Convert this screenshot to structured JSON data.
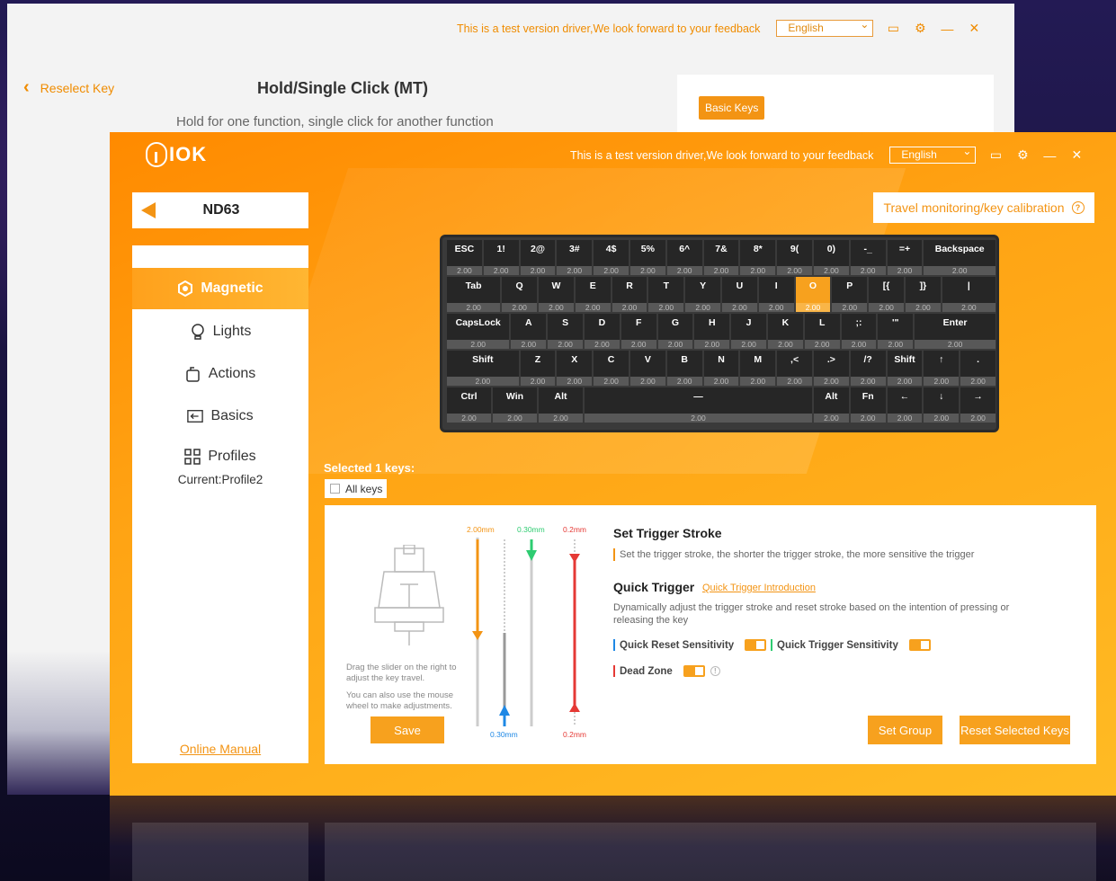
{
  "back_window": {
    "notice": "This is a test version driver,We look forward to your feedback",
    "language": "English",
    "reselect_label": "Reselect Key",
    "title": "Hold/Single Click (MT)",
    "subtitle": "Hold for one function, single click for another function",
    "basic_keys_label": "Basic Keys"
  },
  "main_window": {
    "logo_text": "IOK",
    "notice": "This is a test version driver,We look forward to your feedback",
    "language": "English",
    "device_name": "ND63",
    "travel_button": "Travel monitoring/key calibration",
    "colors": {
      "accent": "#f7a11e",
      "background": "#ff9a0a",
      "trigger_red": "#e53935",
      "trigger_green": "#2ecc71",
      "trigger_blue": "#1e88e5"
    }
  },
  "sidebar": {
    "items": [
      {
        "label": "Magnetic",
        "icon": "hexagon-icon",
        "active": true
      },
      {
        "label": "Lights",
        "icon": "lightbulb-icon",
        "active": false
      },
      {
        "label": "Actions",
        "icon": "actions-icon",
        "active": false
      },
      {
        "label": "Basics",
        "icon": "basics-icon",
        "active": false
      },
      {
        "label": "Profiles",
        "icon": "grid-icon",
        "active": false
      }
    ],
    "current_profile": "Current:Profile2",
    "manual_link": "Online Manual"
  },
  "keyboard": {
    "rows": [
      {
        "keys": [
          {
            "label": "ESC",
            "value": "2.00"
          },
          {
            "label": "1!",
            "value": "2.00"
          },
          {
            "label": "2@",
            "value": "2.00"
          },
          {
            "label": "3#",
            "value": "2.00"
          },
          {
            "label": "4$",
            "value": "2.00"
          },
          {
            "label": "5%",
            "value": "2.00"
          },
          {
            "label": "6^",
            "value": "2.00"
          },
          {
            "label": "7&",
            "value": "2.00"
          },
          {
            "label": "8*",
            "value": "2.00"
          },
          {
            "label": "9(",
            "value": "2.00"
          },
          {
            "label": "0)",
            "value": "2.00"
          },
          {
            "label": "-_",
            "value": "2.00"
          },
          {
            "label": "=+",
            "value": "2.00"
          },
          {
            "label": "Backspace",
            "value": "2.00",
            "w": 2
          }
        ]
      },
      {
        "keys": [
          {
            "label": "Tab",
            "value": "2.00",
            "w": 1.5
          },
          {
            "label": "Q",
            "value": "2.00"
          },
          {
            "label": "W",
            "value": "2.00"
          },
          {
            "label": "E",
            "value": "2.00"
          },
          {
            "label": "R",
            "value": "2.00"
          },
          {
            "label": "T",
            "value": "2.00"
          },
          {
            "label": "Y",
            "value": "2.00"
          },
          {
            "label": "U",
            "value": "2.00"
          },
          {
            "label": "I",
            "value": "2.00"
          },
          {
            "label": "O",
            "value": "2.00",
            "selected": true
          },
          {
            "label": "P",
            "value": "2.00"
          },
          {
            "label": "[{",
            "value": "2.00"
          },
          {
            "label": "]}",
            "value": "2.00"
          },
          {
            "label": "|",
            "value": "2.00",
            "w": 1.5
          }
        ]
      },
      {
        "keys": [
          {
            "label": "CapsLock",
            "value": "2.00",
            "w": 1.75
          },
          {
            "label": "A",
            "value": "2.00"
          },
          {
            "label": "S",
            "value": "2.00"
          },
          {
            "label": "D",
            "value": "2.00"
          },
          {
            "label": "F",
            "value": "2.00"
          },
          {
            "label": "G",
            "value": "2.00"
          },
          {
            "label": "H",
            "value": "2.00"
          },
          {
            "label": "J",
            "value": "2.00"
          },
          {
            "label": "K",
            "value": "2.00"
          },
          {
            "label": "L",
            "value": "2.00"
          },
          {
            "label": ";:",
            "value": "2.00"
          },
          {
            "label": "'\"",
            "value": "2.00"
          },
          {
            "label": "Enter",
            "value": "2.00",
            "w": 2.25
          }
        ]
      },
      {
        "keys": [
          {
            "label": "Shift",
            "value": "2.00",
            "w": 2
          },
          {
            "label": "Z",
            "value": "2.00"
          },
          {
            "label": "X",
            "value": "2.00"
          },
          {
            "label": "C",
            "value": "2.00"
          },
          {
            "label": "V",
            "value": "2.00"
          },
          {
            "label": "B",
            "value": "2.00"
          },
          {
            "label": "N",
            "value": "2.00"
          },
          {
            "label": "M",
            "value": "2.00"
          },
          {
            "label": ",<",
            "value": "2.00"
          },
          {
            "label": ".>",
            "value": "2.00"
          },
          {
            "label": "/?",
            "value": "2.00"
          },
          {
            "label": "Shift",
            "value": "2.00"
          },
          {
            "label": "↑",
            "value": "2.00"
          },
          {
            "label": ".",
            "value": "2.00"
          }
        ]
      },
      {
        "keys": [
          {
            "label": "Ctrl",
            "value": "2.00",
            "w": 1.25
          },
          {
            "label": "Win",
            "value": "2.00",
            "w": 1.25
          },
          {
            "label": "Alt",
            "value": "2.00",
            "w": 1.25
          },
          {
            "label": "—",
            "value": "2.00",
            "w": 6.25
          },
          {
            "label": "Alt",
            "value": "2.00"
          },
          {
            "label": "Fn",
            "value": "2.00"
          },
          {
            "label": "←",
            "value": "2.00"
          },
          {
            "label": "↓",
            "value": "2.00"
          },
          {
            "label": "→",
            "value": "2.00"
          }
        ]
      }
    ]
  },
  "selection": {
    "selected_text": "Selected  1  keys:",
    "all_keys_label": "All keys"
  },
  "panel": {
    "hint1": "Drag the slider on the right to adjust the key travel.",
    "hint2": "You can also use the mouse wheel to make adjustments.",
    "save_label": "Save",
    "slider_top_orange": "2.00mm",
    "slider_top_green": "0.30mm",
    "slider_top_red": "0.2mm",
    "slider_bottom_blue": "0.30mm",
    "slider_bottom_red": "0.2mm",
    "set_trigger_title": "Set Trigger Stroke",
    "set_trigger_desc": "Set the trigger stroke, the shorter the trigger stroke, the more sensitive the trigger",
    "quick_trigger_title": "Quick Trigger",
    "quick_trigger_link": "Quick Trigger Introduction",
    "quick_trigger_desc": "Dynamically adjust the trigger stroke and reset stroke based on the intention of pressing or releasing the key",
    "opt_reset": "Quick Reset Sensitivity",
    "opt_trigger": "Quick Trigger Sensitivity",
    "opt_dead": "Dead Zone",
    "set_group_label": "Set Group",
    "reset_keys_label": "Reset Selected Keys"
  }
}
